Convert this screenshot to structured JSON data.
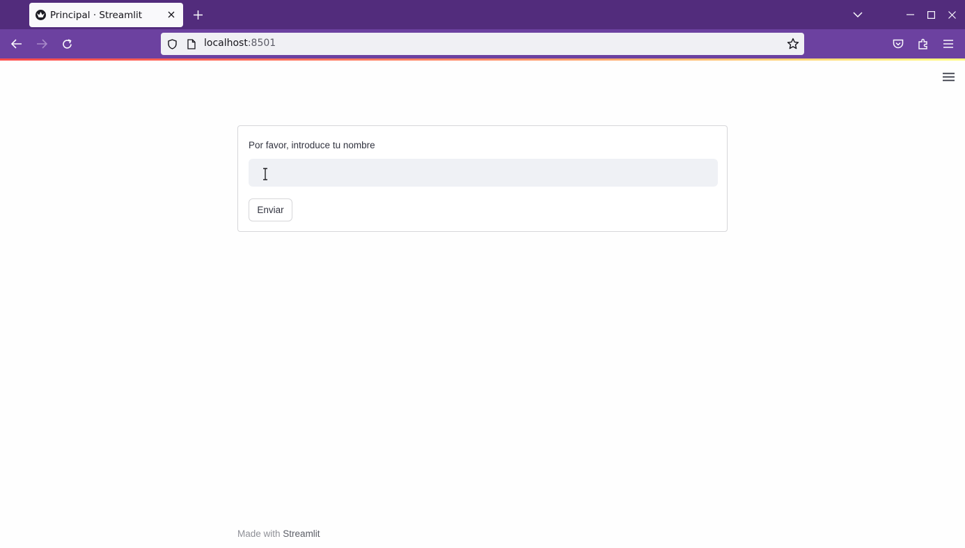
{
  "browser": {
    "tab_title": "Principal · Streamlit",
    "url_host": "localhost",
    "url_port": ":8501"
  },
  "form": {
    "label": "Por favor, introduce tu nombre",
    "input_value": "",
    "submit_label": "Enviar"
  },
  "footer": {
    "prefix": "Made with",
    "brand": "Streamlit"
  },
  "colors": {
    "tabbar": "#522c7c",
    "navbar": "#6c41a0",
    "input_bg": "#eff1f5",
    "text": "#31333f"
  }
}
